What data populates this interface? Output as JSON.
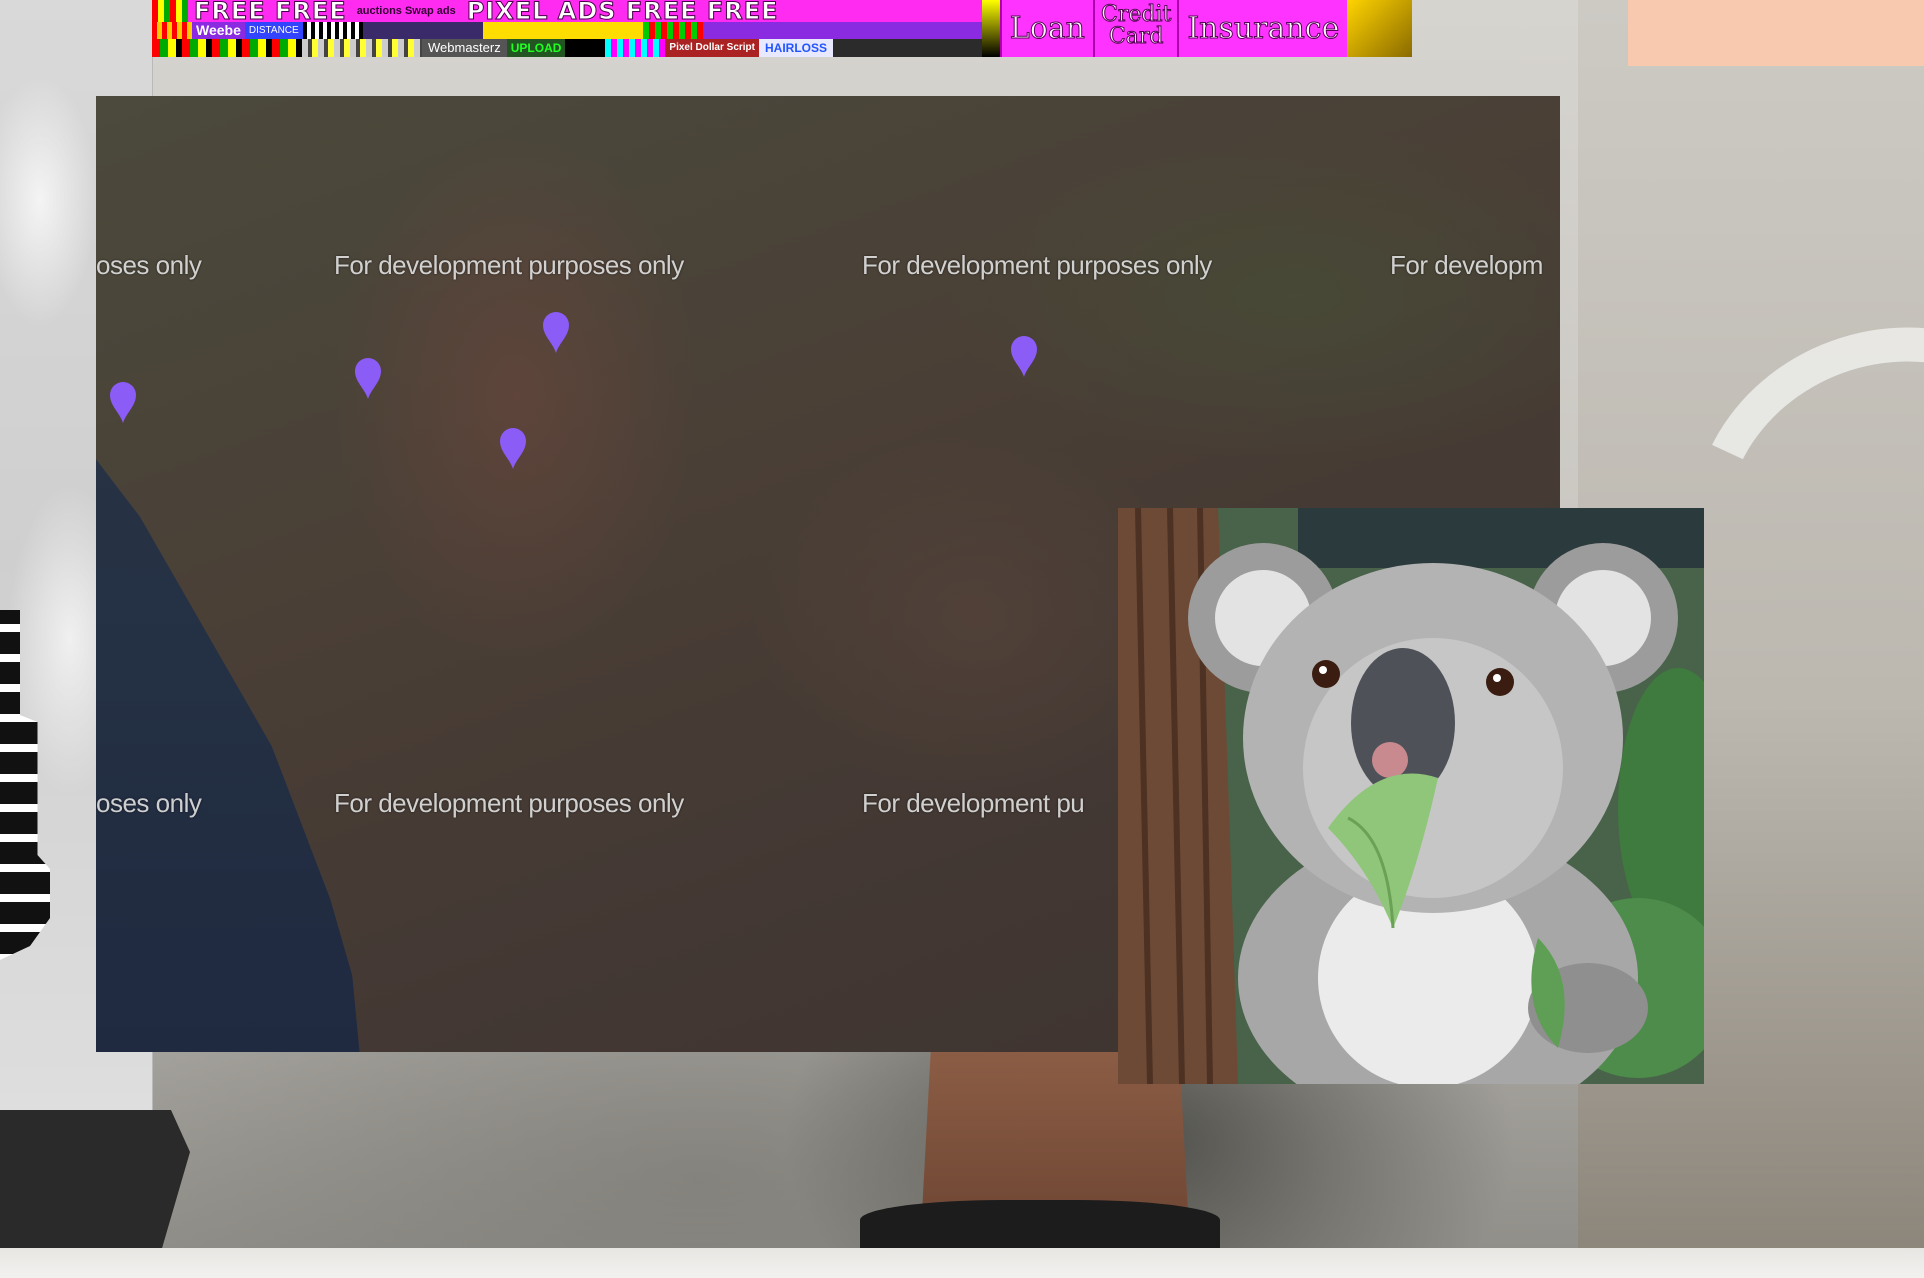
{
  "ads_banner": {
    "headline": "FREE FREE",
    "small_text": "auctions Swap ads",
    "headline_2": "PIXEL ADS FREE FREE",
    "loan": "Loan",
    "credit_card_line1": "Credit",
    "credit_card_line2": "Card",
    "insurance": "Insurance",
    "webmaster": "Webmasterz",
    "upload": "UPLOAD",
    "pixel_dollar": "Pixel Dollar Script",
    "hairloss": "HAIRLOSS",
    "distance": "DISTANCE",
    "weebe": "Weebe"
  },
  "map": {
    "watermark_text": "For development purposes only",
    "watermark_partial_left": "oses only",
    "watermark_partial_right_top": "For developm",
    "watermark_partial_right_bottom": "For development pu",
    "pin_color": "#8b5cf6",
    "pins": [
      {
        "name": "pin-1"
      },
      {
        "name": "pin-2"
      },
      {
        "name": "pin-3"
      },
      {
        "name": "pin-4"
      },
      {
        "name": "pin-5"
      }
    ]
  },
  "colors": {
    "ads_background": "#ff33ff",
    "peach_block": "#f8c9ae",
    "map_land": "#4a3f36",
    "map_ocean": "#243043"
  }
}
